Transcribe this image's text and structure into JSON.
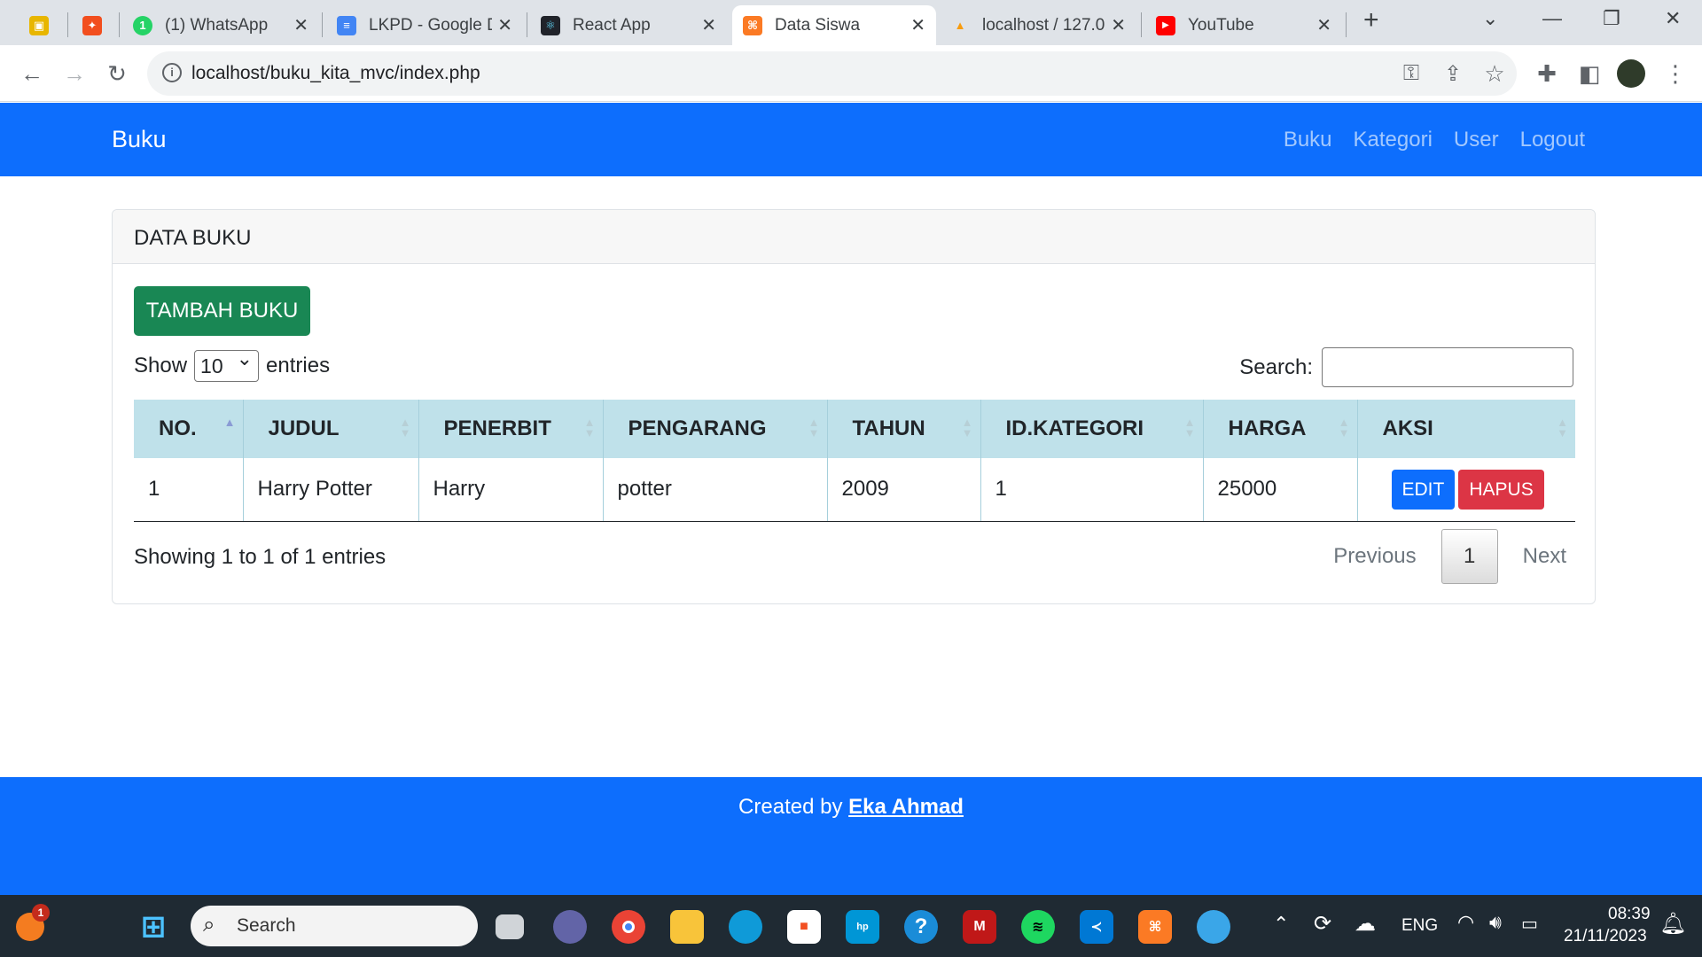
{
  "browser": {
    "tabs": [
      {
        "title": "",
        "icon": "classroom-icon",
        "color": "#e8b600",
        "pinned": true
      },
      {
        "title": "",
        "icon": "figma-icon",
        "color": "#f24e1e",
        "pinned": true
      },
      {
        "title": "(1) WhatsApp",
        "icon": "whatsapp-icon",
        "color": "#25d366"
      },
      {
        "title": "LKPD - Google D",
        "icon": "google-docs-icon",
        "color": "#4285f4"
      },
      {
        "title": "React App",
        "icon": "react-icon",
        "color": "#20232a"
      },
      {
        "title": "Data Siswa",
        "icon": "xampp-icon",
        "color": "#fb7a24",
        "active": true
      },
      {
        "title": "localhost / 127.0",
        "icon": "phpmyadmin-icon",
        "color": "#f89c0e"
      },
      {
        "title": "YouTube",
        "icon": "youtube-icon",
        "color": "#ff0000"
      }
    ],
    "url": "localhost/buku_kita_mvc/index.php"
  },
  "navbar": {
    "brand": "Buku",
    "links": [
      "Buku",
      "Kategori",
      "User",
      "Logout"
    ]
  },
  "card": {
    "header": "DATA BUKU",
    "add_button": "TAMBAH BUKU",
    "show_label": "Show",
    "entries_value": "10",
    "entries_label": "entries",
    "search_label": "Search:",
    "search_value": ""
  },
  "table": {
    "columns": [
      "NO.",
      "JUDUL",
      "PENERBIT",
      "PENGARANG",
      "TAHUN",
      "ID.KATEGORI",
      "HARGA",
      "AKSI"
    ],
    "rows": [
      {
        "no": "1",
        "judul": "Harry Potter",
        "penerbit": "Harry",
        "pengarang": "potter",
        "tahun": "2009",
        "kategori": "1",
        "harga": "25000",
        "edit": "EDIT",
        "hapus": "HAPUS"
      }
    ],
    "info": "Showing 1 to 1 of 1 entries",
    "pager": {
      "previous": "Previous",
      "current": "1",
      "next": "Next"
    }
  },
  "footer": {
    "prefix": "Created by ",
    "author": "Eka Ahmad"
  },
  "taskbar": {
    "search": "Search",
    "lang": "ENG",
    "time": "08:39",
    "date": "21/11/2023",
    "notification_count": "1"
  },
  "colors": {
    "primary": "#0d6efd",
    "success": "#198754",
    "danger": "#dc3545",
    "table_header": "#bfe1ea"
  }
}
